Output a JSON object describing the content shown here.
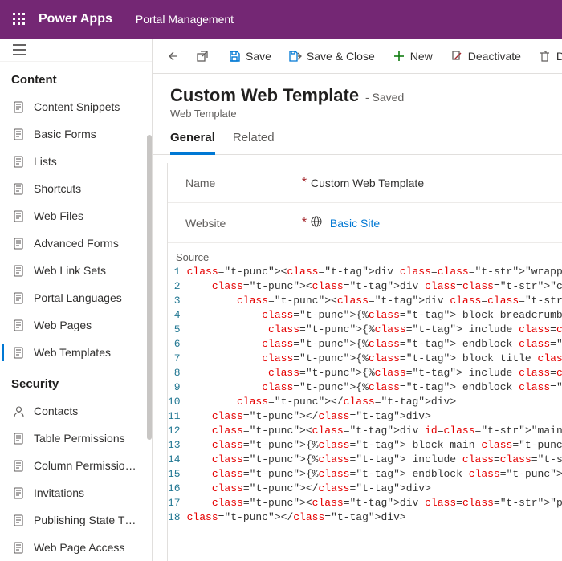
{
  "header": {
    "brand": "Power Apps",
    "portal": "Portal Management"
  },
  "sidebar": {
    "section1": "Content",
    "items1": [
      {
        "label": "Content Snippets",
        "icon": "doc"
      },
      {
        "label": "Basic Forms",
        "icon": "form"
      },
      {
        "label": "Lists",
        "icon": "list"
      },
      {
        "label": "Shortcuts",
        "icon": "shortcut"
      },
      {
        "label": "Web Files",
        "icon": "file"
      },
      {
        "label": "Advanced Forms",
        "icon": "form"
      },
      {
        "label": "Web Link Sets",
        "icon": "link"
      },
      {
        "label": "Portal Languages",
        "icon": "lang"
      },
      {
        "label": "Web Pages",
        "icon": "page"
      },
      {
        "label": "Web Templates",
        "icon": "template"
      }
    ],
    "section2": "Security",
    "items2": [
      {
        "label": "Contacts",
        "icon": "person"
      },
      {
        "label": "Table Permissions",
        "icon": "perm"
      },
      {
        "label": "Column Permissio…",
        "icon": "colperm"
      },
      {
        "label": "Invitations",
        "icon": "invite"
      },
      {
        "label": "Publishing State T…",
        "icon": "pub"
      },
      {
        "label": "Web Page Access",
        "icon": "access"
      }
    ]
  },
  "commands": {
    "back": "",
    "popout": "",
    "save": "Save",
    "saveclose": "Save & Close",
    "new": "New",
    "deactivate": "Deactivate",
    "delete": "De"
  },
  "page": {
    "title": "Custom Web Template",
    "status": "- Saved",
    "subtitle": "Web Template"
  },
  "tabs": {
    "general": "General",
    "related": "Related"
  },
  "form": {
    "name_label": "Name",
    "name_value": "Custom Web Template",
    "website_label": "Website",
    "website_value": "Basic Site",
    "source_label": "Source"
  },
  "code": {
    "lines": [
      "<div class=\"wrapper-body\">",
      "    <div class=\"container\">",
      "        <div class=\"page-heading\">",
      "            {% block breadcrumbs %}",
      "             {% include 'Breadcrumbs' %}",
      "            {% endblock %}",
      "            {% block title %}",
      "             {% include 'Page Header' %}",
      "            {% endblock %}",
      "        </div>",
      "    </div>",
      "    <div id=\"mainContent\">",
      "    {% block main %}",
      "    {% include 'Page Copy' %}",
      "    {% endblock %}",
      "    </div>",
      "    <div class=\"push\"></div>",
      "</div>"
    ]
  }
}
